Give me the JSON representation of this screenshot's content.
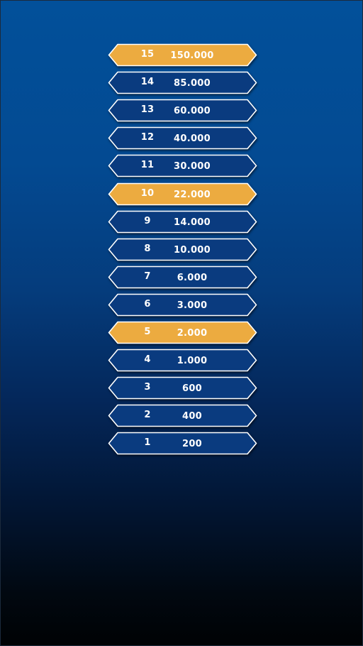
{
  "colors": {
    "milestone_fill": "#ecab40",
    "regular_fill": "#0a3b7f",
    "outline": "#ffffff",
    "text": "#ffffff"
  },
  "ladder": {
    "rungs": [
      {
        "level": "15",
        "amount": "150.000",
        "milestone": true
      },
      {
        "level": "14",
        "amount": "85.000",
        "milestone": false
      },
      {
        "level": "13",
        "amount": "60.000",
        "milestone": false
      },
      {
        "level": "12",
        "amount": "40.000",
        "milestone": false
      },
      {
        "level": "11",
        "amount": "30.000",
        "milestone": false
      },
      {
        "level": "10",
        "amount": "22.000",
        "milestone": true
      },
      {
        "level": "9",
        "amount": "14.000",
        "milestone": false
      },
      {
        "level": "8",
        "amount": "10.000",
        "milestone": false
      },
      {
        "level": "7",
        "amount": "6.000",
        "milestone": false
      },
      {
        "level": "6",
        "amount": "3.000",
        "milestone": false
      },
      {
        "level": "5",
        "amount": "2.000",
        "milestone": true
      },
      {
        "level": "4",
        "amount": "1.000",
        "milestone": false
      },
      {
        "level": "3",
        "amount": "600",
        "milestone": false
      },
      {
        "level": "2",
        "amount": "400",
        "milestone": false
      },
      {
        "level": "1",
        "amount": "200",
        "milestone": false
      }
    ]
  }
}
